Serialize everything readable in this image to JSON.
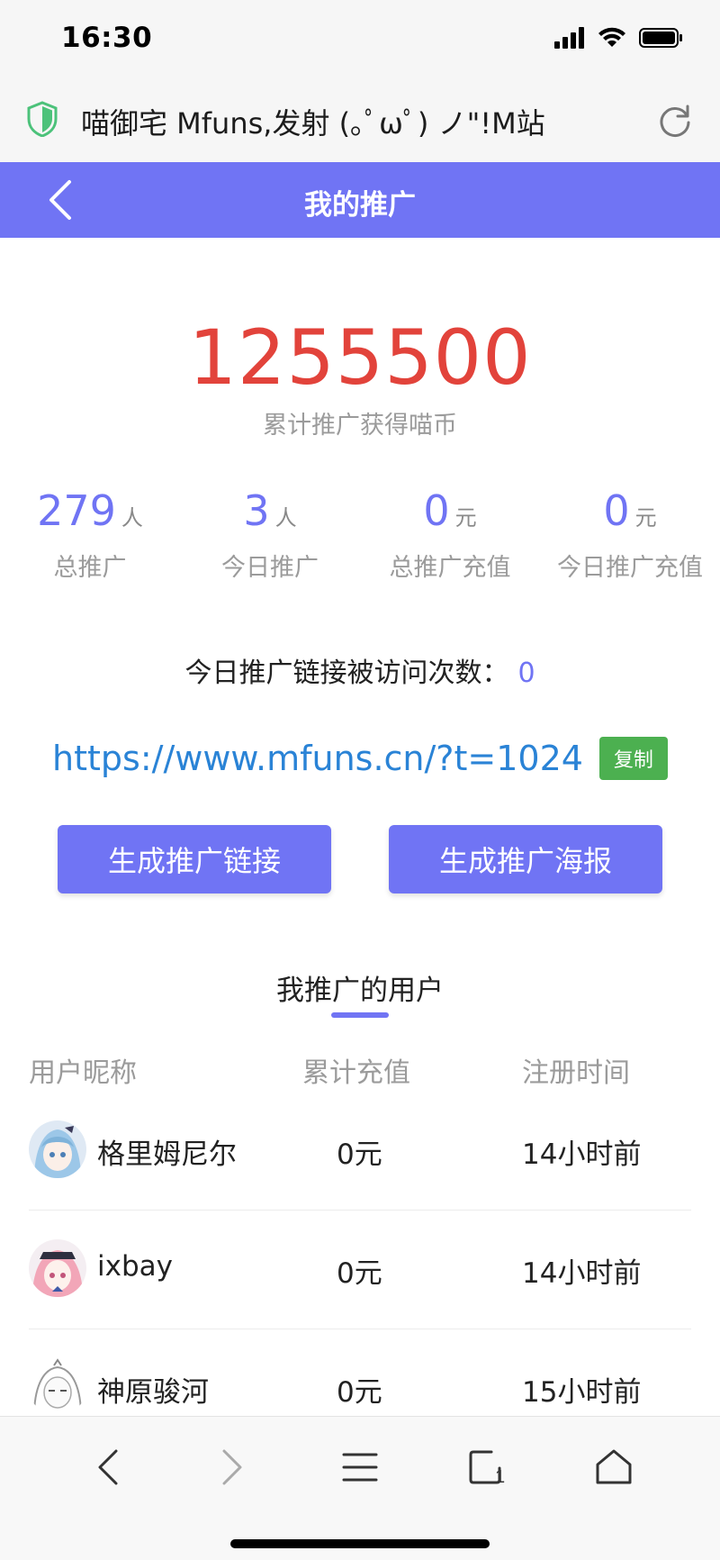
{
  "status_bar": {
    "time": "16:30"
  },
  "browser": {
    "site_title": "喵御宅 Mfuns,发射 (｡ﾟωﾟ) ノ\"!M站"
  },
  "header": {
    "title": "我的推广"
  },
  "summary": {
    "total_coins": "1255500",
    "total_coins_label": "累计推广获得喵币"
  },
  "stats": [
    {
      "value": "279",
      "unit": "人",
      "label": "总推广"
    },
    {
      "value": "3",
      "unit": "人",
      "label": "今日推广"
    },
    {
      "value": "0",
      "unit": "元",
      "label": "总推广充值"
    },
    {
      "value": "0",
      "unit": "元",
      "label": "今日推广充值"
    }
  ],
  "visits": {
    "label": "今日推广链接被访问次数：",
    "count": "0"
  },
  "promo": {
    "link": "https://www.mfuns.cn/?t=1024",
    "copy_label": "复制"
  },
  "actions": {
    "generate_link": "生成推广链接",
    "generate_poster": "生成推广海报"
  },
  "users_section": {
    "title": "我推广的用户",
    "columns": [
      "用户昵称",
      "累计充值",
      "注册时间"
    ],
    "rows": [
      {
        "name": "格里姆尼尔",
        "recharge": "0元",
        "time": "14小时前"
      },
      {
        "name": "ixbay",
        "recharge": "0元",
        "time": "14小时前"
      },
      {
        "name": "神原骏河",
        "recharge": "0元",
        "time": "15小时前"
      }
    ]
  },
  "colors": {
    "accent": "#7074f4",
    "coins": "#e2433b",
    "link": "#2a83d6",
    "copy": "#4cb050"
  },
  "icons": {
    "status": [
      "signal-icon",
      "wifi-icon",
      "battery-icon"
    ],
    "toolbar": [
      "back-arrow-icon",
      "forward-arrow-icon",
      "menu-icon",
      "tabs-icon",
      "home-icon"
    ]
  }
}
